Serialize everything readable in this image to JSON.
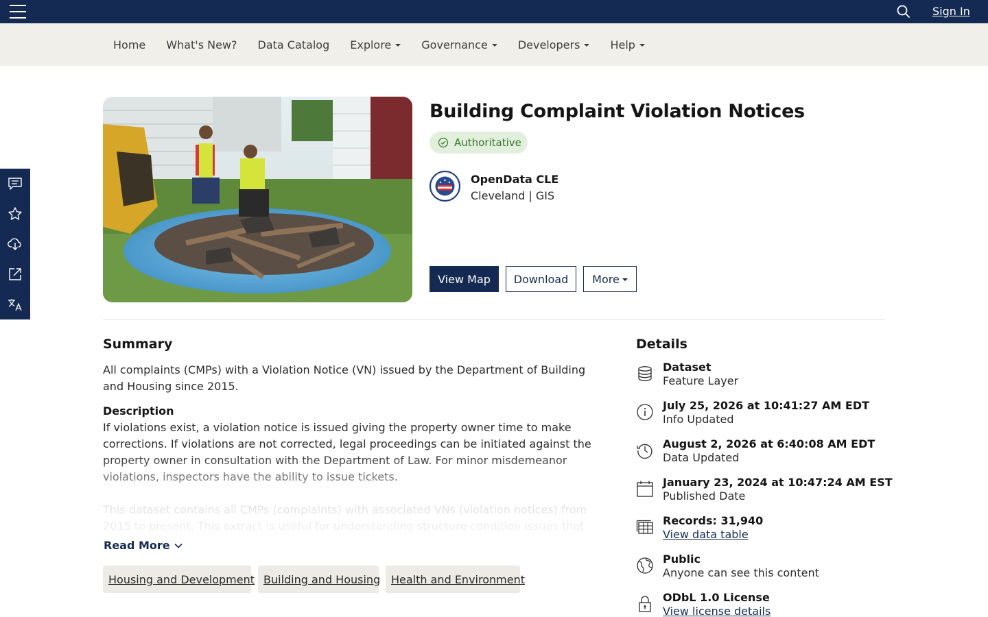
{
  "topbar": {
    "signin_label": "Sign In"
  },
  "nav": {
    "items": [
      {
        "label": "Home"
      },
      {
        "label": "What's New?"
      },
      {
        "label": "Data Catalog"
      },
      {
        "label": "Explore"
      },
      {
        "label": "Governance"
      },
      {
        "label": "Developers"
      },
      {
        "label": "Help"
      }
    ]
  },
  "side_rail": {
    "icons": [
      "comment-icon",
      "star-icon",
      "cloud-download-icon",
      "share-icon",
      "translate-icon"
    ]
  },
  "item": {
    "title": "Building Complaint Violation Notices",
    "badge": "Authoritative",
    "org_name": "OpenData CLE",
    "org_sub": "Cleveland | GIS",
    "buttons": {
      "view_map": "View Map",
      "download": "Download",
      "more": "More"
    }
  },
  "summary": {
    "heading": "Summary",
    "text": "All complaints (CMPs) with a Violation Notice (VN) issued by the Department of Building and Housing since 2015."
  },
  "description": {
    "heading": "Description",
    "text": "If violations exist, a violation notice is issued giving the property owner time to make corrections. If violations are not corrected, legal proceedings can be initiated against the property owner in consultation with the Department of Law. For minor misdemeanor violations, inspectors have the ability to issue tickets.",
    "faded_text": "This dataset contains all CMPs (complaints) with associated VNs (violation notices) from 2015 to present. This extract is useful for understanding structure condition issues that are being",
    "read_more": "Read More"
  },
  "tags": [
    "Housing and Development",
    "Building and Housing",
    "Health and Environment"
  ],
  "details": {
    "heading": "Details",
    "rows": [
      {
        "icon": "database-icon",
        "title": "Dataset",
        "sub": "Feature Layer"
      },
      {
        "icon": "info-icon",
        "title": "July 25, 2026 at 10:41:27 AM EDT",
        "sub": "Info Updated"
      },
      {
        "icon": "history-icon",
        "title": "August 2, 2026 at 6:40:08 AM EDT",
        "sub": "Data Updated"
      },
      {
        "icon": "calendar-icon",
        "title": "January 23, 2024 at 10:47:24 AM EST",
        "sub": "Published Date"
      },
      {
        "icon": "table-icon",
        "title": "Records: 31,940",
        "sub": "View data table"
      },
      {
        "icon": "globe-icon",
        "title": "Public",
        "sub": "Anyone can see this content"
      },
      {
        "icon": "lock-icon",
        "title": "ODbL 1.0 License",
        "sub": "View license details"
      }
    ]
  },
  "colors": {
    "brand_navy": "#152a52",
    "nav_bg": "#f1efea",
    "badge_bg": "#e2efdc",
    "badge_text": "#3a7431",
    "tag_bg": "#ecebe6"
  }
}
